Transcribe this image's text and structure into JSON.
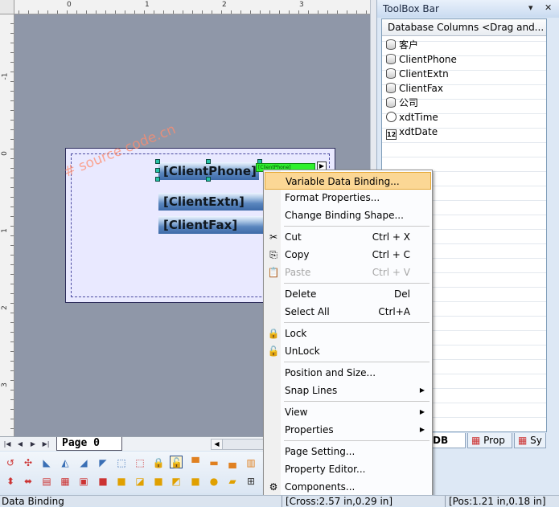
{
  "ruler": {
    "top_labels": [
      "0",
      "1",
      "2",
      "3"
    ],
    "left_labels": [
      "-1",
      "0",
      "1",
      "2",
      "3"
    ]
  },
  "report": {
    "fields": [
      {
        "label": "[ClientPhone]"
      },
      {
        "label": "[ClientExtn]"
      },
      {
        "label": "[ClientFax]"
      }
    ],
    "green_box_text": "[ClientPhone]",
    "watermark": "# source code.cn"
  },
  "pagebar": {
    "tab_label": "Page  0"
  },
  "toolbox": {
    "title": "ToolBox Bar",
    "pin_icon": "▾",
    "close_icon": "✕",
    "header": "Database Columns <Drag and...",
    "items": [
      {
        "label": "客户",
        "icon": "database-column-icon"
      },
      {
        "label": "ClientPhone",
        "icon": "database-column-icon"
      },
      {
        "label": "ClientExtn",
        "icon": "database-column-icon"
      },
      {
        "label": "ClientFax",
        "icon": "database-column-icon"
      },
      {
        "label": "公司",
        "icon": "database-column-icon"
      },
      {
        "label": "xdtTime",
        "icon": "clock-icon"
      },
      {
        "label": "xdtDate",
        "icon": "calendar-icon"
      }
    ],
    "calendar_glyph": "12",
    "tabs": [
      {
        "label": "DB"
      },
      {
        "label": "Prop"
      },
      {
        "label": "Sy"
      }
    ]
  },
  "context_menu": {
    "items": [
      {
        "label": "Variable Data Binding...",
        "shortcut": "",
        "highlighted": true
      },
      {
        "label": "Format Properties...",
        "shortcut": ""
      },
      {
        "label": "Change Binding Shape...",
        "shortcut": ""
      },
      {
        "label": "Cut",
        "shortcut": "Ctrl + X",
        "icon": "scissors-icon"
      },
      {
        "label": "Copy",
        "shortcut": "Ctrl + C",
        "icon": "copy-icon"
      },
      {
        "label": "Paste",
        "shortcut": "Ctrl + V",
        "icon": "paste-icon",
        "disabled": true
      },
      {
        "label": "Delete",
        "shortcut": "Del"
      },
      {
        "label": "Select All",
        "shortcut": "Ctrl+A"
      },
      {
        "label": "Lock",
        "shortcut": "",
        "icon": "lock-icon"
      },
      {
        "label": "UnLock",
        "shortcut": "",
        "icon": "unlock-icon"
      },
      {
        "label": "Position and Size...",
        "shortcut": ""
      },
      {
        "label": "Snap Lines",
        "shortcut": "",
        "submenu": true
      },
      {
        "label": "View",
        "shortcut": "",
        "submenu": true
      },
      {
        "label": "Properties",
        "shortcut": "",
        "submenu": true
      },
      {
        "label": "Page Setting...",
        "shortcut": ""
      },
      {
        "label": "Property Editor...",
        "shortcut": ""
      },
      {
        "label": "Components...",
        "shortcut": "",
        "icon": "components-icon"
      }
    ],
    "submenu_arrow": "▶"
  },
  "status": {
    "left": "Data Binding",
    "cross": "[Cross:2.57 in,0.29 in]",
    "pos": "[Pos:1.21 in,0.18 in]"
  },
  "colors": {
    "menu_highlight": "#fbd795",
    "field_gradient_dark": "#3d6aa8",
    "green_box": "#2ef02e",
    "canvas": "#8f97a8",
    "report_section": "#e9e9ff"
  }
}
